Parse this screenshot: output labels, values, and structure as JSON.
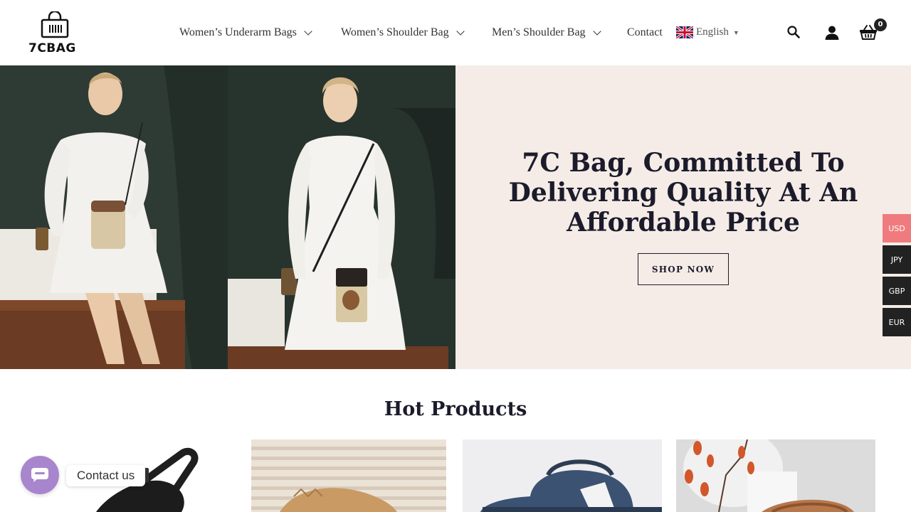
{
  "brand": {
    "logo_text": "7CBAG"
  },
  "nav": {
    "items": [
      {
        "label": "Women’s Underarm Bags"
      },
      {
        "label": "Women’s Shoulder Bag"
      },
      {
        "label": "Men’s Shoulder Bag"
      },
      {
        "label": "Contact"
      }
    ],
    "language": "English"
  },
  "header_icons": [
    "search-icon",
    "user-icon",
    "cart-icon"
  ],
  "cart": {
    "count": "0"
  },
  "hero": {
    "title": "7C Bag, Committed To Delivering Quality At An Affordable Price",
    "button_label": "SHOP NOW"
  },
  "currencies": [
    "USD",
    "JPY",
    "GBP",
    "EUR"
  ],
  "hot_products": {
    "title": "Hot Products"
  },
  "contact_widget": {
    "label": "Contact us"
  },
  "colors": {
    "hero_panel_bg": "#f5ece7",
    "active_currency": "#ef7b7e",
    "contact_button": "#a886cd",
    "heading": "#1b1b2b"
  }
}
